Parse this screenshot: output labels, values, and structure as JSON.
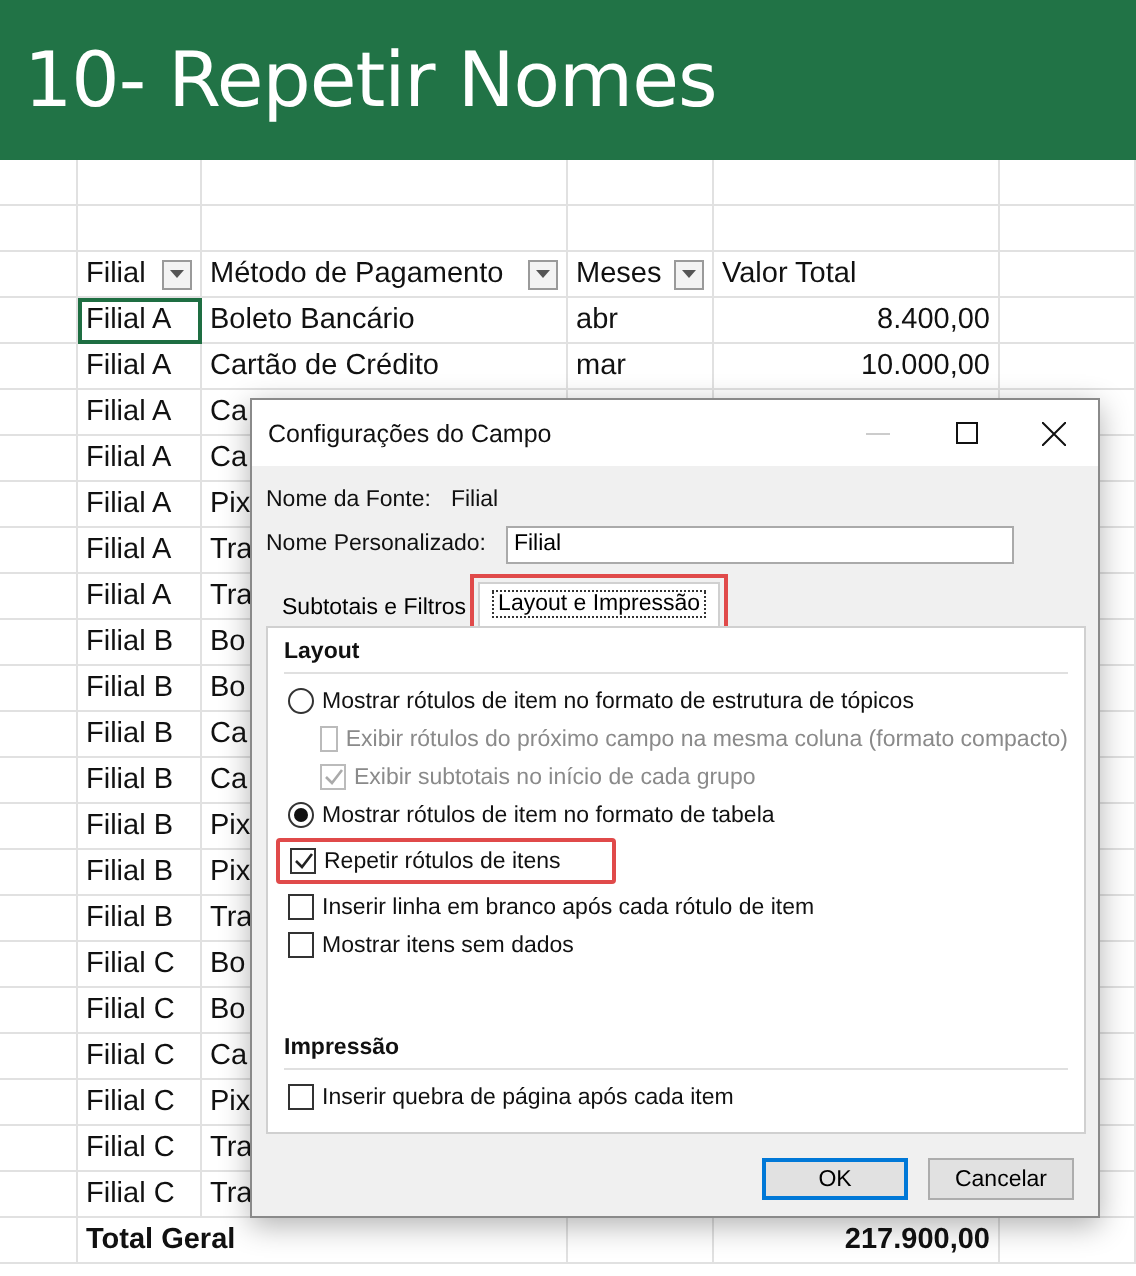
{
  "banner": {
    "title": "10- Repetir Nomes"
  },
  "sheet": {
    "columns": [
      {
        "label": "Filial",
        "filter": true
      },
      {
        "label": "Método de Pagamento",
        "filter": true
      },
      {
        "label": "Meses",
        "filter": true
      },
      {
        "label": "Valor Total",
        "filter": false
      }
    ],
    "rows": [
      {
        "filial": "Filial A",
        "metodo": "Boleto Bancário",
        "mes": "abr",
        "valor": "8.400,00",
        "selected": true
      },
      {
        "filial": "Filial A",
        "metodo": "Cartão de Crédito",
        "mes": "mar",
        "valor": "10.000,00",
        "selected": false
      },
      {
        "filial": "Filial A",
        "metodo": "Ca",
        "selected": false
      },
      {
        "filial": "Filial A",
        "metodo": "Ca",
        "selected": false
      },
      {
        "filial": "Filial A",
        "metodo": "Pix",
        "selected": false
      },
      {
        "filial": "Filial A",
        "metodo": "Tra",
        "selected": false
      },
      {
        "filial": "Filial A",
        "metodo": "Tra",
        "selected": false
      },
      {
        "filial": "Filial B",
        "metodo": "Bo",
        "selected": false
      },
      {
        "filial": "Filial B",
        "metodo": "Bo",
        "selected": false
      },
      {
        "filial": "Filial B",
        "metodo": "Ca",
        "selected": false
      },
      {
        "filial": "Filial B",
        "metodo": "Ca",
        "selected": false
      },
      {
        "filial": "Filial B",
        "metodo": "Pix",
        "selected": false
      },
      {
        "filial": "Filial B",
        "metodo": "Pix",
        "selected": false
      },
      {
        "filial": "Filial B",
        "metodo": "Tra",
        "selected": false
      },
      {
        "filial": "Filial C",
        "metodo": "Bo",
        "selected": false
      },
      {
        "filial": "Filial C",
        "metodo": "Bo",
        "selected": false
      },
      {
        "filial": "Filial C",
        "metodo": "Ca",
        "selected": false
      },
      {
        "filial": "Filial C",
        "metodo": "Pix",
        "selected": false
      },
      {
        "filial": "Filial C",
        "metodo": "Tra",
        "selected": false
      },
      {
        "filial": "Filial C",
        "metodo": "Tra",
        "selected": false
      }
    ],
    "total": {
      "label": "Total Geral",
      "valor": "217.900,00"
    }
  },
  "dialog": {
    "title": "Configurações do Campo",
    "source_label": "Nome da Fonte:",
    "source_value": "Filial",
    "custom_label": "Nome Personalizado:",
    "custom_value": "Filial",
    "tabs": [
      {
        "label": "Subtotais e Filtros",
        "selected": false,
        "highlighted": false
      },
      {
        "label": "Layout e Impressão",
        "selected": true,
        "highlighted": true
      }
    ],
    "sections": [
      {
        "title": "Layout",
        "options": [
          {
            "kind": "radio",
            "label": "Mostrar rótulos de item no formato de estrutura de tópicos",
            "checked": false,
            "disabled": false,
            "indented": false,
            "highlighted": false
          },
          {
            "kind": "checkbox",
            "label": "Exibir rótulos do próximo campo na mesma coluna (formato compacto)",
            "checked": false,
            "disabled": true,
            "indented": true,
            "highlighted": false
          },
          {
            "kind": "checkbox",
            "label": "Exibir subtotais no início de cada grupo",
            "checked": true,
            "disabled": true,
            "indented": true,
            "highlighted": false
          },
          {
            "kind": "radio",
            "label": "Mostrar rótulos de item no formato de tabela",
            "checked": true,
            "disabled": false,
            "indented": false,
            "highlighted": false
          },
          {
            "kind": "checkbox",
            "label": "Repetir rótulos de itens",
            "checked": true,
            "disabled": false,
            "indented": false,
            "highlighted": true
          },
          {
            "kind": "checkbox",
            "label": "Inserir linha em branco após cada rótulo de item",
            "checked": false,
            "disabled": false,
            "indented": false,
            "highlighted": false
          },
          {
            "kind": "checkbox",
            "label": "Mostrar itens sem dados",
            "checked": false,
            "disabled": false,
            "indented": false,
            "highlighted": false
          }
        ]
      },
      {
        "title": "Impressão",
        "options": [
          {
            "kind": "checkbox",
            "label": "Inserir quebra de página após cada item",
            "checked": false,
            "disabled": false,
            "indented": false,
            "highlighted": false
          }
        ]
      }
    ],
    "buttons": [
      {
        "label": "OK",
        "default": true
      },
      {
        "label": "Cancelar",
        "default": false
      }
    ]
  }
}
